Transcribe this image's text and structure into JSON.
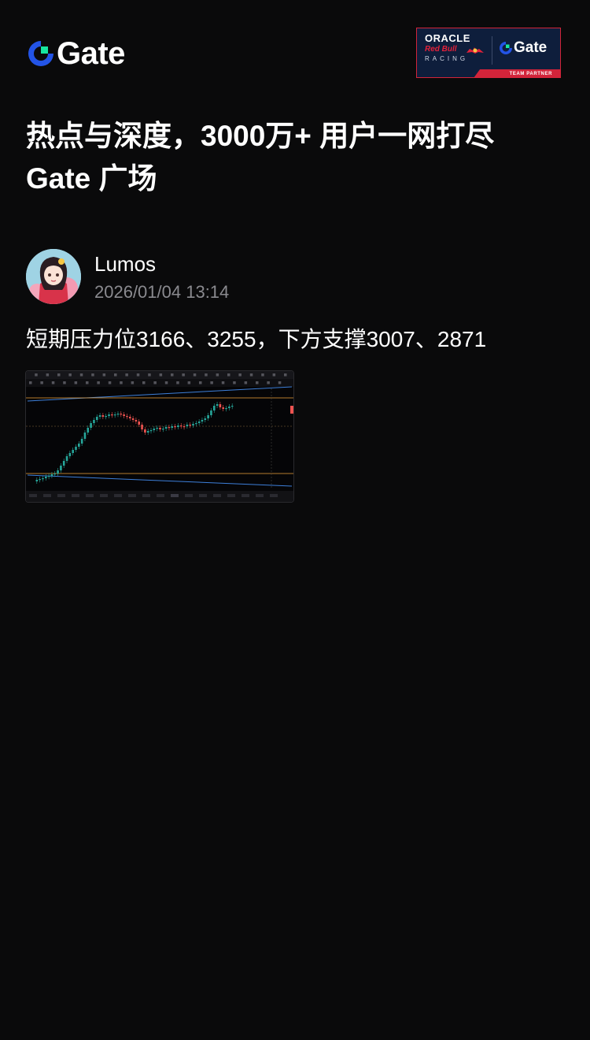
{
  "header": {
    "logo_text": "Gate",
    "logo_icon": "gate-logo-icon",
    "banner": {
      "oracle": "ORACLE",
      "redbull": "Red Bull",
      "racing": "RACING",
      "gate": "Gate",
      "partner": "TEAM PARTNER"
    }
  },
  "headline": {
    "line1": "热点与深度，3000万+ 用户一网打尽",
    "line2": "Gate 广场"
  },
  "post": {
    "author": "Lumos",
    "time": "2026/01/04 13:14",
    "text": "短期压力位3166、3255，下方支撑3007、2871"
  },
  "colors": {
    "background": "#0a0a0b",
    "brand_blue": "#2354e6",
    "brand_green": "#17e6a1",
    "candle_up": "#26a69a",
    "candle_down": "#ef5350",
    "level_line": "#f0a53a",
    "trend_line": "#3d7fd9"
  }
}
